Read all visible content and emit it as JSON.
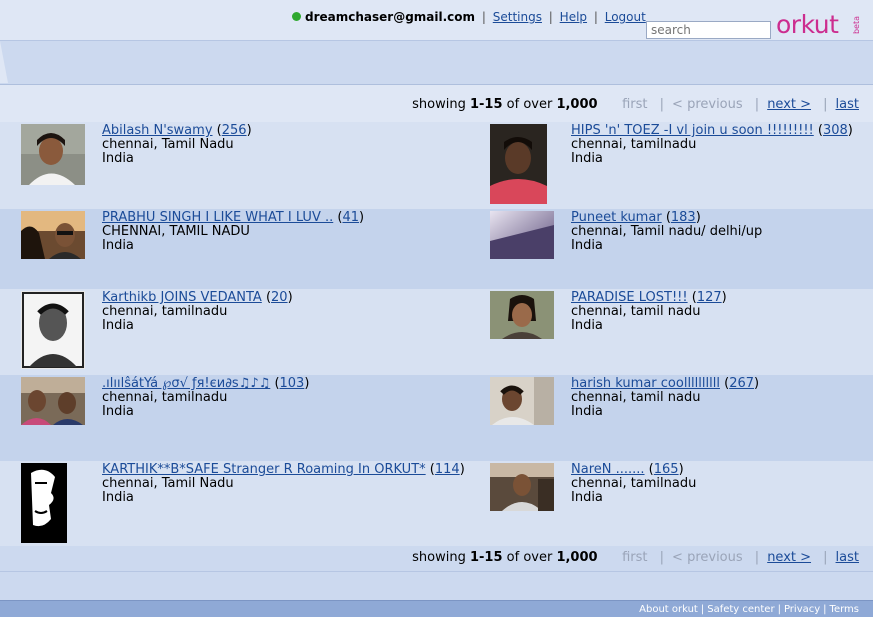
{
  "header": {
    "email": "dreamchaser@gmail.com",
    "links": [
      "Settings",
      "Help",
      "Logout"
    ],
    "search_placeholder": "search",
    "logo": "orkut",
    "beta": "beta"
  },
  "pager": {
    "showing": "showing",
    "range": "1-15",
    "of_over": "of over",
    "total": "1,000",
    "first": "first",
    "previous": "< previous",
    "next": "next >",
    "last": "last"
  },
  "colors": {
    "accent": "#cc2d8f",
    "link": "#1b4b98",
    "online": "#2fa82f"
  },
  "results": [
    {
      "name": "Abilash N'swamy",
      "count": "256",
      "city": "chennai, Tamil Nadu",
      "country": "India"
    },
    {
      "name": "HIPS 'n' TOEZ -I vl join u soon !!!!!!!!!",
      "count": "308",
      "city": "chennai, tamilnadu",
      "country": "India"
    },
    {
      "name": "PRABHU SINGH I LIKE WHAT I LUV ..",
      "count": "41",
      "city": "CHENNAI, TAMIL NADU",
      "country": "India"
    },
    {
      "name": "Puneet kumar",
      "count": "183",
      "city": "chennai, Tamil nadu/ delhi/up",
      "country": "India"
    },
    {
      "name": "Karthikb JOINS VEDANTA",
      "count": "20",
      "city": "chennai, tamilnadu",
      "country": "India"
    },
    {
      "name": "PARADISE LOST!!!",
      "count": "127",
      "city": "chennai, tamil nadu",
      "country": "India"
    },
    {
      "name": ".ılıılŝátYá ℘σ√ ƒя!єи∂ѕ♫♪♫",
      "count": "103",
      "city": "chennai, tamilnadu",
      "country": "India"
    },
    {
      "name": "harish kumar coollllllllll",
      "count": "267",
      "city": "chennai, tamil nadu",
      "country": "India"
    },
    {
      "name": "KARTHIK**B*SAFE Stranger R Roaming In ORKUT*",
      "count": "114",
      "city": "chennai, Tamil Nadu",
      "country": "India"
    },
    {
      "name": "NareN .......",
      "count": "165",
      "city": "chennai, tamilnadu",
      "country": "India"
    }
  ],
  "footer": {
    "links": [
      "About orkut",
      "Safety center",
      "Privacy",
      "Terms"
    ]
  }
}
